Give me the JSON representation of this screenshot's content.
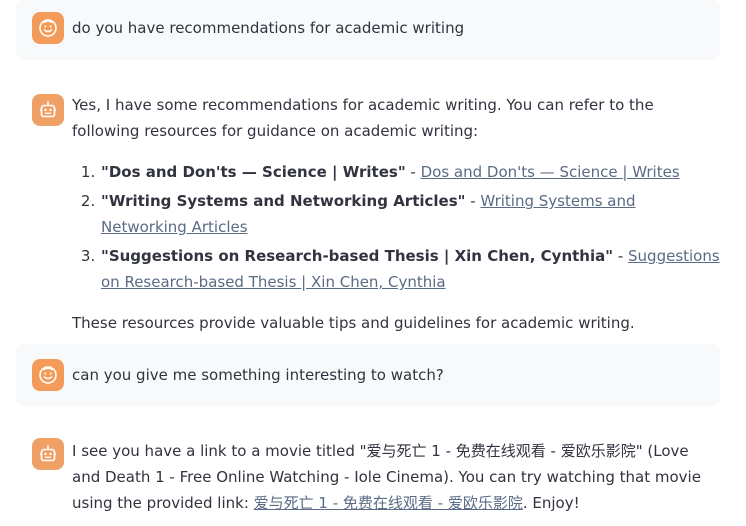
{
  "messages": {
    "m1": {
      "role": "user",
      "text": "do you have recommendations for academic writing"
    },
    "m2": {
      "role": "assistant",
      "intro": "Yes, I have some recommendations for academic writing. You can refer to the following resources for guidance on academic writing:",
      "list": [
        {
          "title": "\"Dos and Don'ts — Science | Writes\"",
          "sep": " - ",
          "link": "Dos and Don'ts — Science | Writes"
        },
        {
          "title": "\"Writing Systems and Networking Articles\"",
          "sep": " - ",
          "link": "Writing Systems and Networking Articles"
        },
        {
          "title": "\"Suggestions on Research-based Thesis | Xin Chen, Cynthia\"",
          "sep": " - ",
          "link": "Suggestions on Research-based Thesis | Xin Chen, Cynthia"
        }
      ],
      "outro": "These resources provide valuable tips and guidelines for academic writing."
    },
    "m3": {
      "role": "user",
      "text": "can you give me something interesting to watch?"
    },
    "m4": {
      "role": "assistant",
      "text_before": "I see you have a link to a movie titled \"爱与死亡 1 - 免费在线观看 - 爱欧乐影院\" (Love and Death 1 - Free Online Watching - Iole Cinema). You can try watching that movie using the provided link: ",
      "link": "爱与死亡 1 - 免费在线观看 - 爱欧乐影院",
      "text_after": ". Enjoy!"
    }
  },
  "colors": {
    "user_bubble_bg": "#f8f9fb",
    "avatar_orange": "#f39c5a",
    "link": "#5b6b84",
    "text": "#31333f"
  },
  "icons": {
    "user_avatar": "smiley-face-icon",
    "assistant_avatar": "robot-face-icon"
  }
}
